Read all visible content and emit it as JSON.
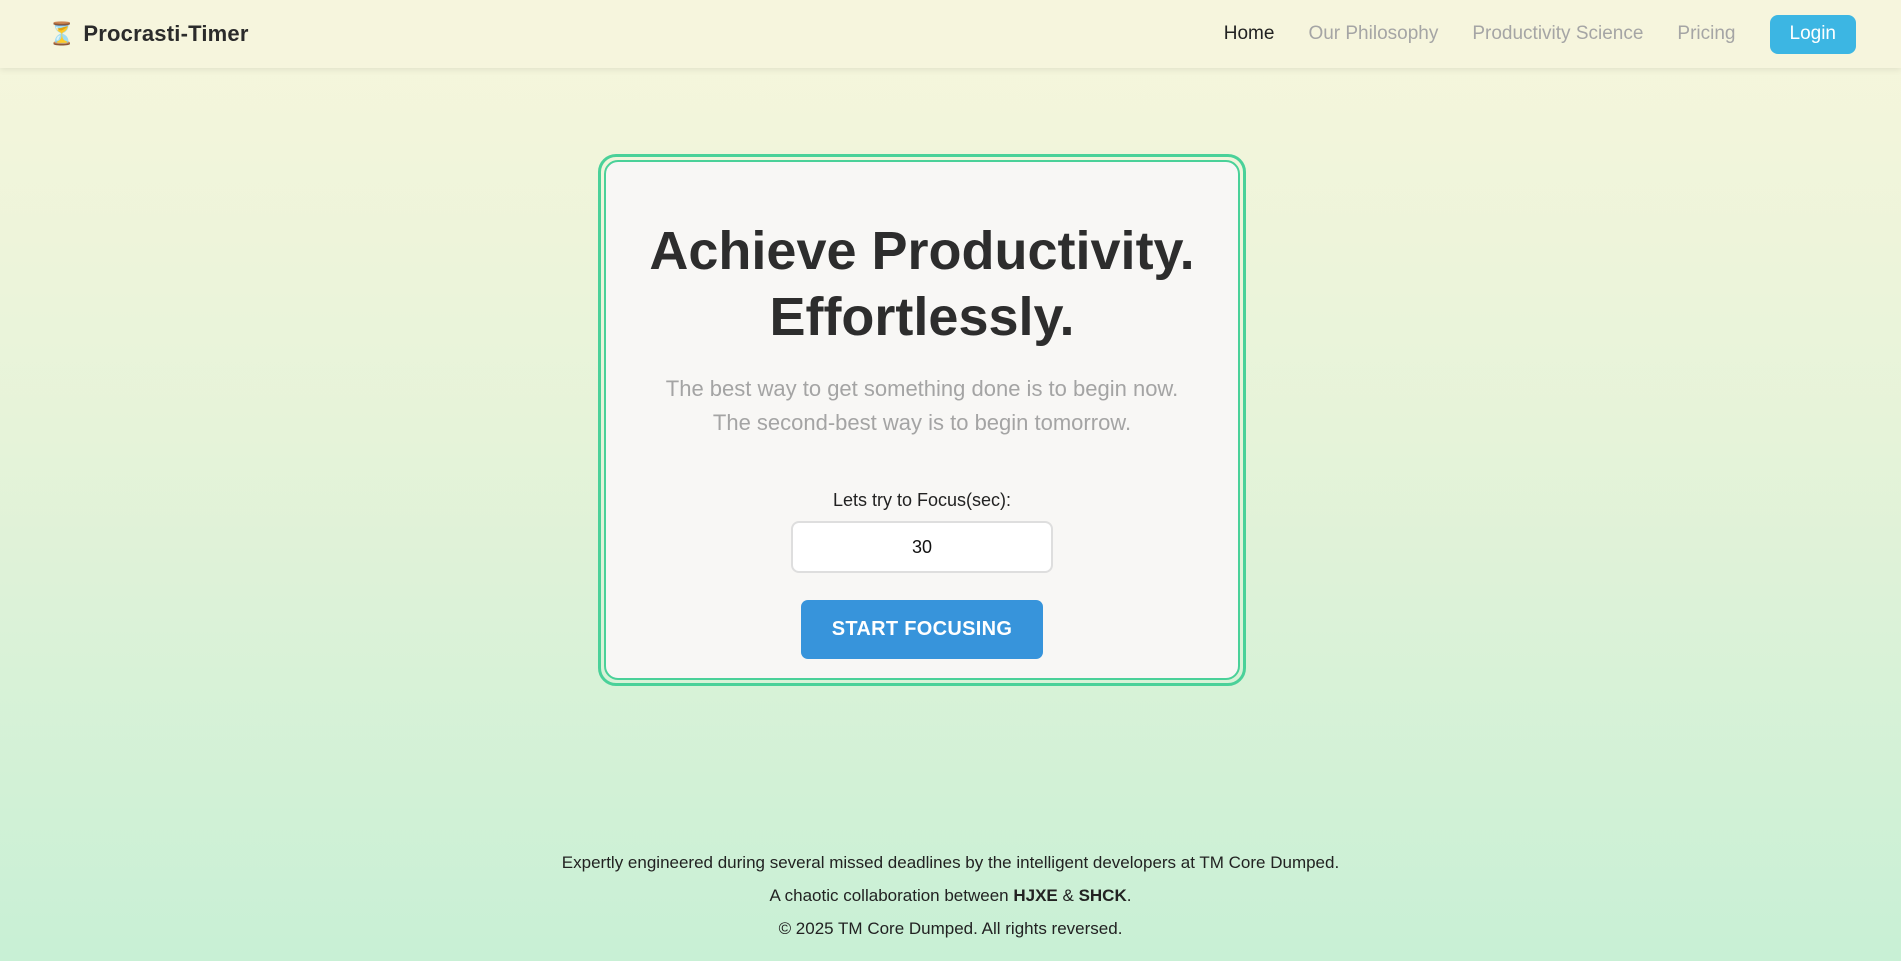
{
  "brand": {
    "icon": "hourglass-icon",
    "icon_glyph": "⏳",
    "name": "Procrasti-Timer"
  },
  "nav": {
    "items": [
      {
        "label": "Home",
        "active": true
      },
      {
        "label": "Our Philosophy",
        "active": false
      },
      {
        "label": "Productivity Science",
        "active": false
      },
      {
        "label": "Pricing",
        "active": false
      }
    ],
    "login_label": "Login"
  },
  "hero": {
    "headline_line1": "Achieve Productivity.",
    "headline_line2": "Effortlessly.",
    "subtitle_line1": "The best way to get something done is to begin now.",
    "subtitle_line2": "The second-best way is to begin tomorrow."
  },
  "focus": {
    "label": "Lets try to Focus(sec):",
    "value": "30",
    "button_label": "START FOCUSING"
  },
  "footer": {
    "line1": "Expertly engineered during several missed deadlines by the intelligent developers at TM Core Dumped.",
    "line2_prefix": "A chaotic collaboration between ",
    "line2_name1": "HJXE",
    "line2_sep": " & ",
    "line2_name2": "SHCK",
    "line2_suffix": ".",
    "line3": "© 2025 TM Core Dumped. All rights reversed."
  },
  "colors": {
    "accent_blue": "#3794db",
    "login_blue": "#3cb6e3",
    "card_border_green": "#4ad199"
  }
}
